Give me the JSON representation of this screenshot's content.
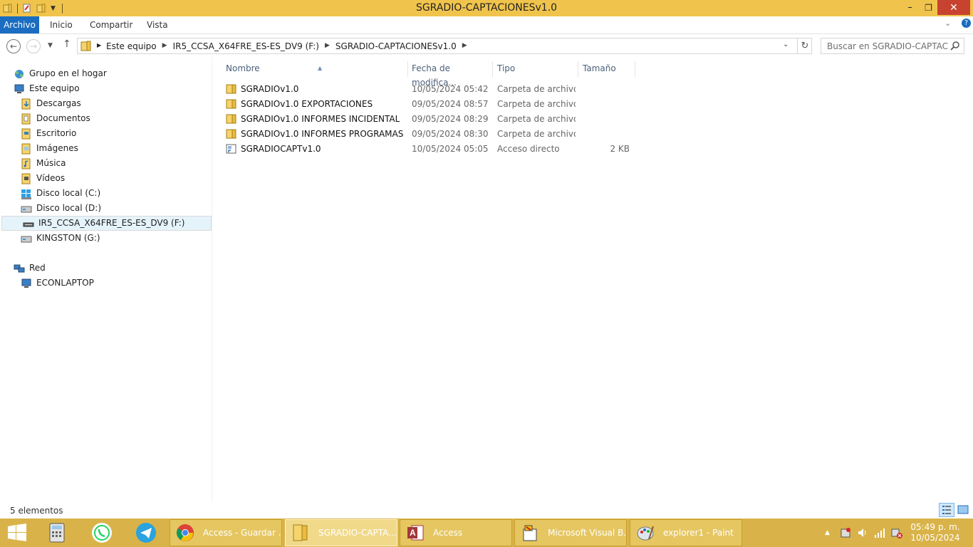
{
  "window": {
    "title": "SGRADIO-CAPTACIONESv1.0",
    "minimize": "–",
    "maximize": "❐",
    "close": "✕"
  },
  "ribbon": {
    "tabs": [
      "Archivo",
      "Inicio",
      "Compartir",
      "Vista"
    ]
  },
  "address": {
    "crumbs": [
      "Este equipo",
      "IR5_CCSA_X64FRE_ES-ES_DV9 (F:)",
      "SGRADIO-CAPTACIONESv1.0"
    ]
  },
  "search": {
    "placeholder": "Buscar en SGRADIO-CAPTACI..."
  },
  "navpane": {
    "homegroup": "Grupo en el hogar",
    "thispc": "Este equipo",
    "items": [
      {
        "label": "Descargas",
        "icon": "downloads-folder-icon"
      },
      {
        "label": "Documentos",
        "icon": "documents-folder-icon"
      },
      {
        "label": "Escritorio",
        "icon": "desktop-folder-icon"
      },
      {
        "label": "Imágenes",
        "icon": "pictures-folder-icon"
      },
      {
        "label": "Música",
        "icon": "music-folder-icon"
      },
      {
        "label": "Vídeos",
        "icon": "videos-folder-icon"
      },
      {
        "label": "Disco local (C:)",
        "icon": "windows-drive-icon"
      },
      {
        "label": "Disco local (D:)",
        "icon": "drive-icon"
      },
      {
        "label": "IR5_CCSA_X64FRE_ES-ES_DV9 (F:)",
        "icon": "dvd-drive-icon"
      },
      {
        "label": "KINGSTON (G:)",
        "icon": "usb-drive-icon"
      }
    ],
    "network": "Red",
    "network_items": [
      {
        "label": "ECONLAPTOP",
        "icon": "computer-icon"
      }
    ]
  },
  "columns": {
    "name": "Nombre",
    "date": "Fecha de modifica...",
    "type": "Tipo",
    "size": "Tamaño"
  },
  "files": [
    {
      "name": "SGRADIOv1.0",
      "date": "10/05/2024 05:42 ...",
      "type": "Carpeta de archivos",
      "size": "",
      "icon": "folder-icon"
    },
    {
      "name": "SGRADIOv1.0 EXPORTACIONES",
      "date": "09/05/2024 08:57 a...",
      "type": "Carpeta de archivos",
      "size": "",
      "icon": "folder-icon"
    },
    {
      "name": "SGRADIOv1.0 INFORMES INCIDENTAL",
      "date": "09/05/2024 08:29 a...",
      "type": "Carpeta de archivos",
      "size": "",
      "icon": "folder-icon"
    },
    {
      "name": "SGRADIOv1.0 INFORMES PROGRAMAS",
      "date": "09/05/2024 08:30 a...",
      "type": "Carpeta de archivos",
      "size": "",
      "icon": "folder-icon"
    },
    {
      "name": "SGRADIOCAPTv1.0",
      "date": "10/05/2024 05:05 ...",
      "type": "Acceso directo",
      "size": "2 KB",
      "icon": "shortcut-icon"
    }
  ],
  "status": {
    "count": "5 elementos"
  },
  "taskbar": {
    "tasks": [
      {
        "label": "Access - Guardar ...",
        "icon": "chrome-icon"
      },
      {
        "label": "SGRADIO-CAPTA...",
        "icon": "explorer-icon"
      },
      {
        "label": "Access",
        "icon": "access-icon"
      },
      {
        "label": "Microsoft Visual B...",
        "icon": "vba-icon"
      },
      {
        "label": "explorer1 - Paint",
        "icon": "paint-icon"
      }
    ],
    "clock_time": "05:49 p. m.",
    "clock_date": "10/05/2024"
  },
  "colors": {
    "titlebar": "#f0c44c",
    "taskbar": "#d9b349",
    "file_tab": "#1a6dc0",
    "selection": "#e5f3fb"
  }
}
